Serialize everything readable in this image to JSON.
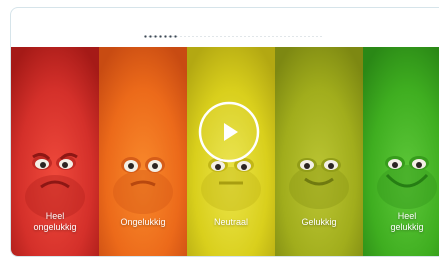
{
  "quiz": {
    "progress_fraction": 0.2
  },
  "play_button": {
    "icon": "play-icon"
  },
  "scale": {
    "options": [
      {
        "label": "Heel\nongelukkig",
        "color": "#d4302a",
        "mood": "very-unhappy"
      },
      {
        "label": "Ongelukkig",
        "color": "#ec6a1a",
        "mood": "unhappy"
      },
      {
        "label": "Neutraal",
        "color": "#d9cf1c",
        "mood": "neutral"
      },
      {
        "label": "Gelukkig",
        "color": "#a1ad1c",
        "mood": "happy"
      },
      {
        "label": "Heel\ngelukkig",
        "color": "#3fae20",
        "mood": "very-happy"
      }
    ]
  }
}
